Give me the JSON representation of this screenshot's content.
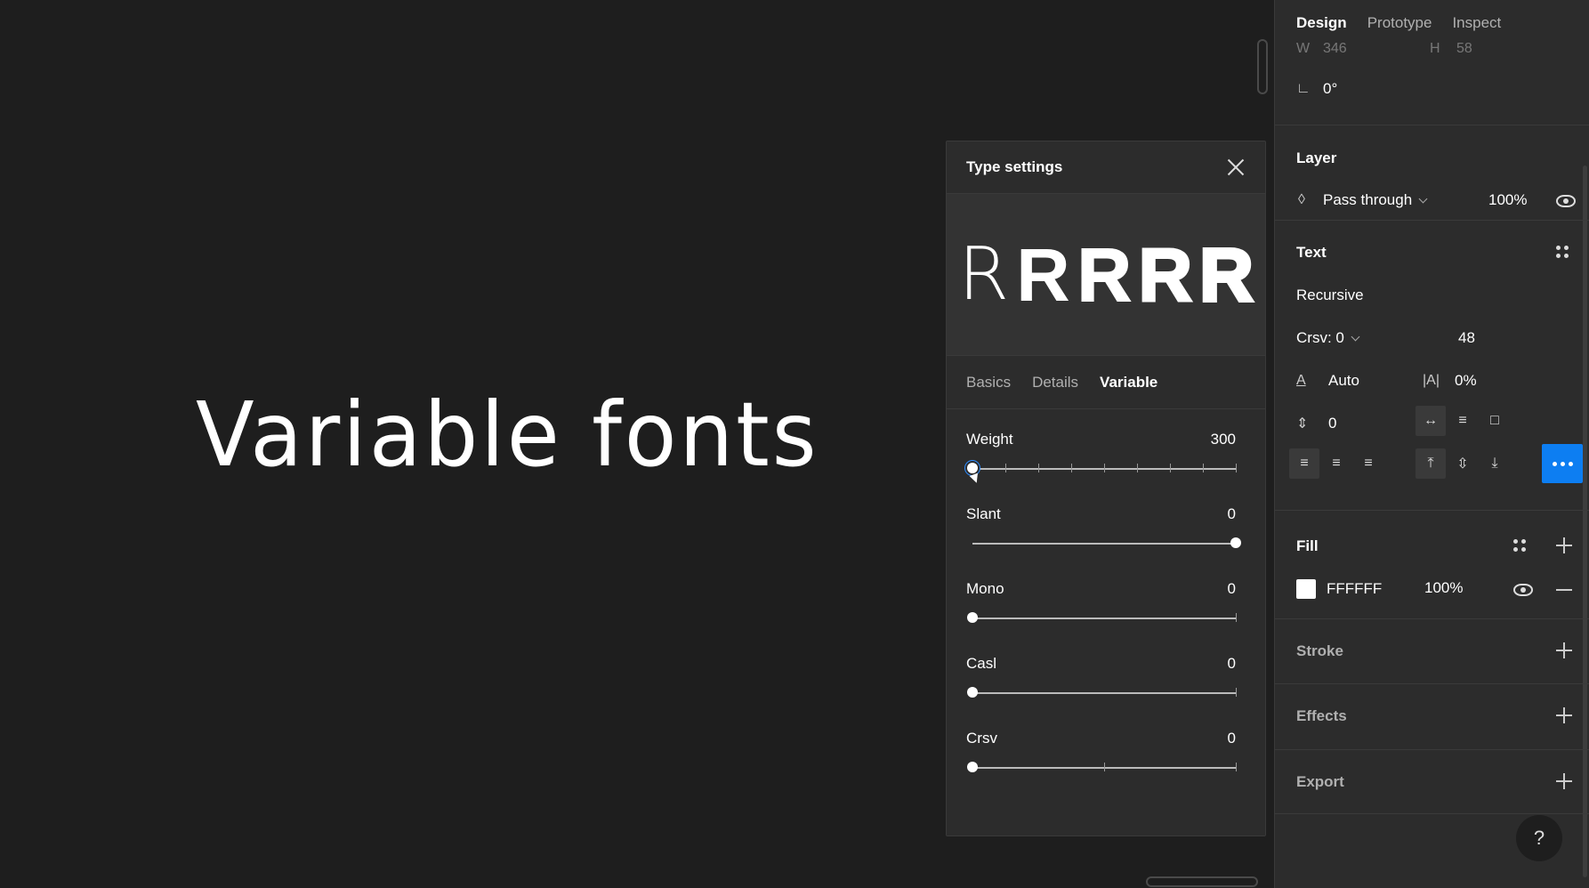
{
  "canvas": {
    "text": "Variable fonts"
  },
  "popup": {
    "title": "Type settings",
    "preview_glyph": "R",
    "tabs": [
      {
        "label": "Basics",
        "active": false
      },
      {
        "label": "Details",
        "active": false
      },
      {
        "label": "Variable",
        "active": true
      }
    ],
    "axes": [
      {
        "label": "Weight",
        "value": "300",
        "position": 0.0,
        "ticks": 7,
        "focused": true
      },
      {
        "label": "Slant",
        "value": "0",
        "position": 1.0,
        "ticks": 0,
        "focused": false
      },
      {
        "label": "Mono",
        "value": "0",
        "position": 0.0,
        "ticks": 0,
        "focused": false
      },
      {
        "label": "Casl",
        "value": "0",
        "position": 0.0,
        "ticks": 0,
        "focused": false
      },
      {
        "label": "Crsv",
        "value": "0",
        "position": 0.0,
        "ticks": 1,
        "focused": false
      }
    ]
  },
  "panel": {
    "tabs": [
      {
        "label": "Design",
        "active": true
      },
      {
        "label": "Prototype",
        "active": false
      },
      {
        "label": "Inspect",
        "active": false
      }
    ],
    "transform": {
      "w_label": "W",
      "w_value": "346",
      "h_label": "H",
      "h_value": "58",
      "rotation": "0°"
    },
    "layer": {
      "title": "Layer",
      "blend_mode": "Pass through",
      "opacity": "100%"
    },
    "text": {
      "title": "Text",
      "font_family": "Recursive",
      "style": "Crsv: 0",
      "size": "48",
      "line_height": "Auto",
      "letter_spacing": "0%",
      "paragraph_spacing": "0"
    },
    "fill": {
      "title": "Fill",
      "hex": "FFFFFF",
      "opacity": "100%",
      "color": "#ffffff"
    },
    "stroke": {
      "title": "Stroke"
    },
    "effects": {
      "title": "Effects"
    },
    "export": {
      "title": "Export"
    },
    "help": "?"
  },
  "colors": {
    "accent": "#0d7ef2",
    "panel_bg": "#2c2c2c",
    "canvas_bg": "#1e1e1e"
  }
}
